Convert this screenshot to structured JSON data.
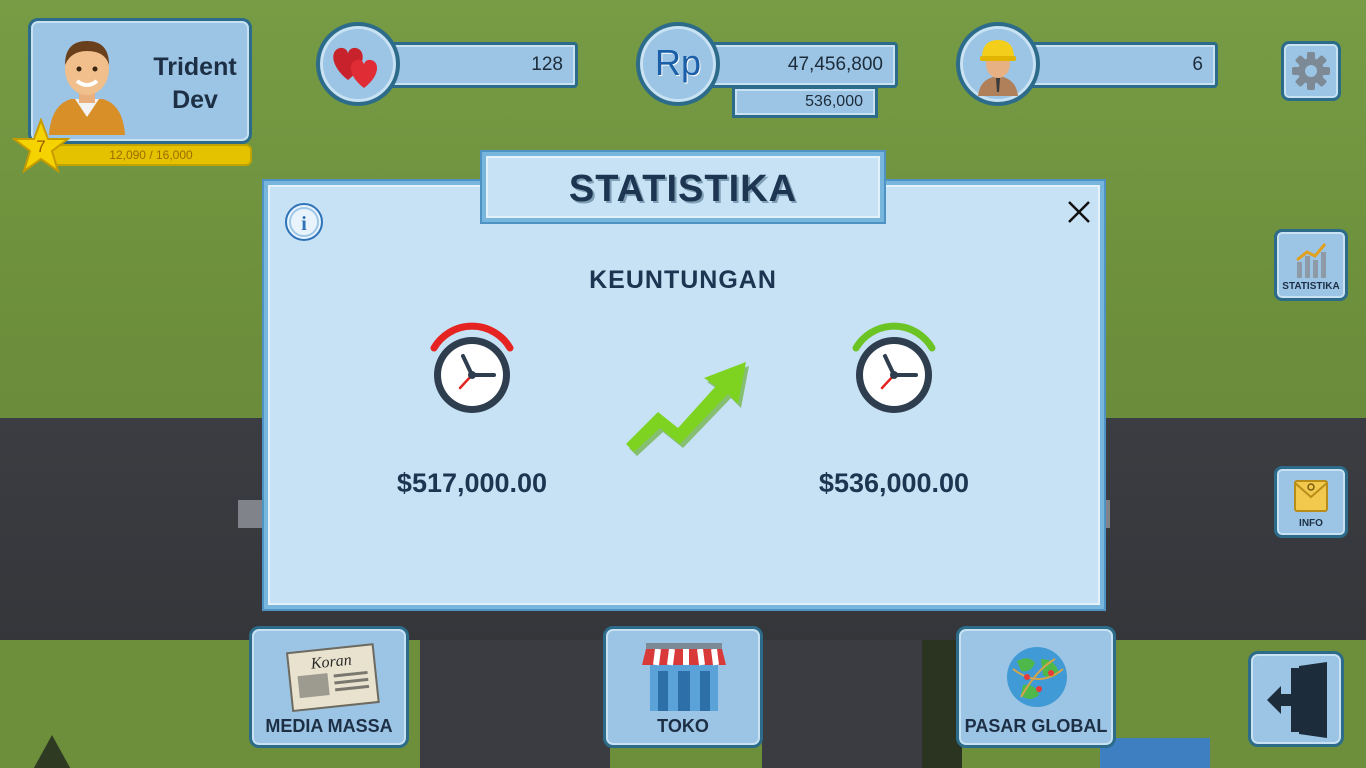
{
  "player": {
    "name_line1": "Trident",
    "name_line2": "Dev",
    "level": "7",
    "xp_text": "12,090 / 16,000",
    "xp_progress": 0.756
  },
  "stats": {
    "hearts": "128",
    "money": "47,456,800",
    "money_sub": "536,000",
    "money_icon": "Rp",
    "workers": "6"
  },
  "side_buttons": {
    "statistika": "STATISTIKA",
    "info": "INFO"
  },
  "bottom_buttons": {
    "media_massa": "MEDIA MASSA",
    "toko": "TOKO",
    "pasar_global": "PASAR GLOBAL"
  },
  "newspaper_label": "Koran",
  "modal": {
    "title": "STATISTIKA",
    "section": "KEUNTUNGAN",
    "before_amount": "$517,000.00",
    "after_amount": "$536,000.00",
    "info_icon": "i"
  },
  "colors": {
    "before_clock_arc": "#e52421",
    "after_clock_arc": "#6cc424",
    "arrow": "#7ed321",
    "panel": "#c7e1f5",
    "border": "#2c6c8a",
    "xp_bar": "#e4c200"
  }
}
